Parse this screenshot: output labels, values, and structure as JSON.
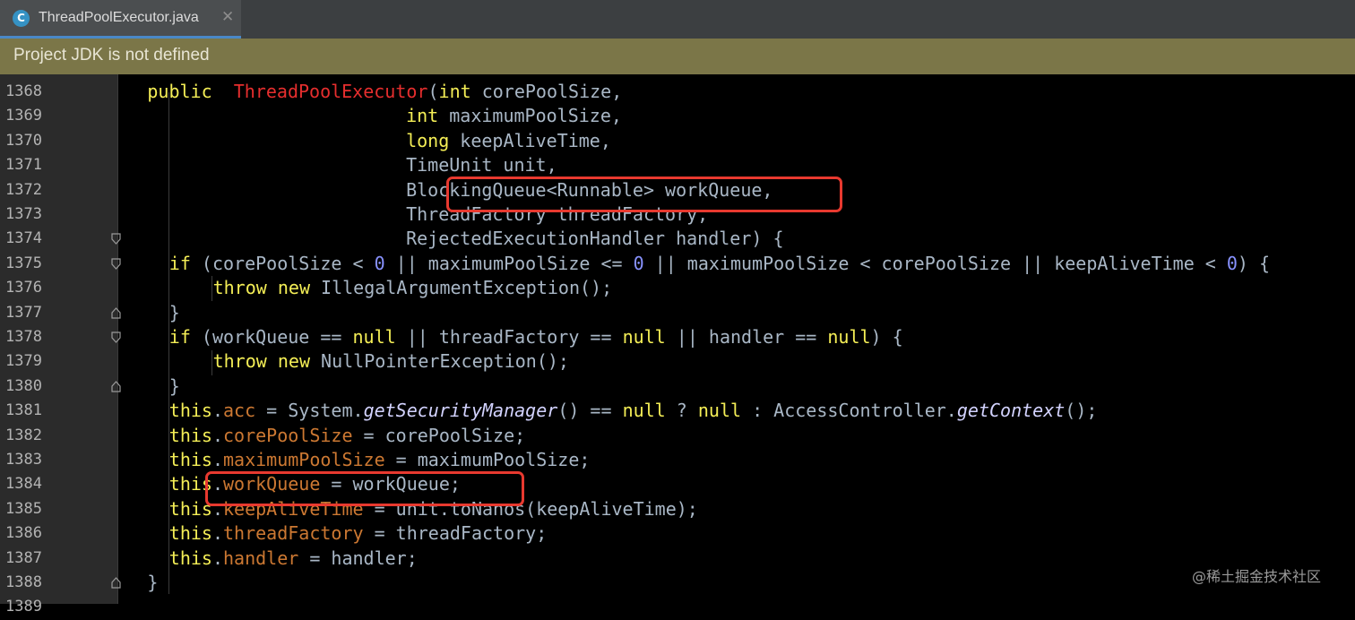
{
  "tab": {
    "icon_letter": "C",
    "title": "ThreadPoolExecutor.java",
    "close_glyph": "✕"
  },
  "banner": {
    "text": "Project JDK is not defined"
  },
  "watermark": "@稀土掘金技术社区",
  "code_lines": [
    {
      "ln": "1368",
      "indent": 2,
      "fold": "",
      "tokens": [
        [
          "kw",
          "public"
        ],
        [
          "",
          "  "
        ],
        [
          "cls",
          "ThreadPoolExecutor"
        ],
        [
          "",
          "("
        ],
        [
          "kw",
          "int"
        ],
        [
          "",
          " corePoolSize,"
        ]
      ]
    },
    {
      "ln": "1369",
      "indent": 0,
      "fold": "",
      "tokens": [
        [
          "",
          "                          "
        ],
        [
          "kw",
          "int"
        ],
        [
          "",
          " maximumPoolSize,"
        ]
      ]
    },
    {
      "ln": "1370",
      "indent": 0,
      "fold": "",
      "tokens": [
        [
          "",
          "                          "
        ],
        [
          "kw",
          "long"
        ],
        [
          "",
          " keepAliveTime,"
        ]
      ]
    },
    {
      "ln": "1371",
      "indent": 0,
      "fold": "",
      "tokens": [
        [
          "",
          "                          TimeUnit unit,"
        ]
      ]
    },
    {
      "ln": "1372",
      "indent": 0,
      "fold": "",
      "tokens": [
        [
          "",
          "                          BlockingQueue<Runnable> workQueue,"
        ]
      ]
    },
    {
      "ln": "1373",
      "indent": 0,
      "fold": "",
      "tokens": [
        [
          "",
          "                          ThreadFactory threadFactory,"
        ]
      ]
    },
    {
      "ln": "1374",
      "indent": 0,
      "fold": "down",
      "tokens": [
        [
          "",
          "                          RejectedExecutionHandler handler) {"
        ]
      ]
    },
    {
      "ln": "1375",
      "indent": 4,
      "fold": "down",
      "tokens": [
        [
          "kw",
          "if"
        ],
        [
          "",
          " (corePoolSize < "
        ],
        [
          "num",
          "0"
        ],
        [
          "",
          " || maximumPoolSize <= "
        ],
        [
          "num",
          "0"
        ],
        [
          "",
          " || maximumPoolSize < corePoolSize || keepAliveTime < "
        ],
        [
          "num",
          "0"
        ],
        [
          "",
          ") {"
        ]
      ]
    },
    {
      "ln": "1376",
      "indent": 8,
      "fold": "",
      "tokens": [
        [
          "kw",
          "throw"
        ],
        [
          "",
          " "
        ],
        [
          "kw",
          "new"
        ],
        [
          "",
          " IllegalArgumentException();"
        ]
      ]
    },
    {
      "ln": "1377",
      "indent": 4,
      "fold": "up",
      "tokens": [
        [
          "",
          "}"
        ]
      ]
    },
    {
      "ln": "1378",
      "indent": 4,
      "fold": "down",
      "tokens": [
        [
          "kw",
          "if"
        ],
        [
          "",
          " (workQueue == "
        ],
        [
          "kw",
          "null"
        ],
        [
          "",
          " || threadFactory == "
        ],
        [
          "kw",
          "null"
        ],
        [
          "",
          " || handler == "
        ],
        [
          "kw",
          "null"
        ],
        [
          "",
          ") {"
        ]
      ]
    },
    {
      "ln": "1379",
      "indent": 8,
      "fold": "",
      "tokens": [
        [
          "kw",
          "throw"
        ],
        [
          "",
          " "
        ],
        [
          "kw",
          "new"
        ],
        [
          "",
          " NullPointerException();"
        ]
      ]
    },
    {
      "ln": "1380",
      "indent": 4,
      "fold": "up",
      "tokens": [
        [
          "",
          "}"
        ]
      ]
    },
    {
      "ln": "1381",
      "indent": 4,
      "fold": "",
      "tokens": [
        [
          "kw",
          "this"
        ],
        [
          "",
          "."
        ],
        [
          "fld",
          "acc"
        ],
        [
          "",
          " = System."
        ],
        [
          "it",
          "getSecurityManager"
        ],
        [
          "",
          "() == "
        ],
        [
          "kw",
          "null"
        ],
        [
          "",
          " ? "
        ],
        [
          "kw",
          "null"
        ],
        [
          "",
          " : AccessController."
        ],
        [
          "it",
          "getContext"
        ],
        [
          "",
          "();"
        ]
      ]
    },
    {
      "ln": "1382",
      "indent": 4,
      "fold": "",
      "tokens": [
        [
          "kw",
          "this"
        ],
        [
          "",
          "."
        ],
        [
          "fld",
          "corePoolSize"
        ],
        [
          "",
          " = corePoolSize;"
        ]
      ]
    },
    {
      "ln": "1383",
      "indent": 4,
      "fold": "",
      "tokens": [
        [
          "kw",
          "this"
        ],
        [
          "",
          "."
        ],
        [
          "fld",
          "maximumPoolSize"
        ],
        [
          "",
          " = maximumPoolSize;"
        ]
      ]
    },
    {
      "ln": "1384",
      "indent": 4,
      "fold": "",
      "tokens": [
        [
          "kw",
          "this"
        ],
        [
          "",
          "."
        ],
        [
          "fld",
          "workQueue"
        ],
        [
          "",
          " = workQueue;"
        ]
      ]
    },
    {
      "ln": "1385",
      "indent": 4,
      "fold": "",
      "tokens": [
        [
          "kw",
          "this"
        ],
        [
          "",
          "."
        ],
        [
          "fld",
          "keepAliveTime"
        ],
        [
          "",
          " = unit.toNanos(keepAliveTime);"
        ]
      ]
    },
    {
      "ln": "1386",
      "indent": 4,
      "fold": "",
      "tokens": [
        [
          "kw",
          "this"
        ],
        [
          "",
          "."
        ],
        [
          "fld",
          "threadFactory"
        ],
        [
          "",
          " = threadFactory;"
        ]
      ]
    },
    {
      "ln": "1387",
      "indent": 4,
      "fold": "",
      "tokens": [
        [
          "kw",
          "this"
        ],
        [
          "",
          "."
        ],
        [
          "fld",
          "handler"
        ],
        [
          "",
          " = handler;"
        ]
      ]
    },
    {
      "ln": "1388",
      "indent": 2,
      "fold": "up",
      "tokens": [
        [
          "",
          "}"
        ]
      ]
    },
    {
      "ln": "1389",
      "indent": 0,
      "fold": "",
      "tokens": []
    }
  ],
  "highlights": [
    "1372",
    "1384"
  ],
  "colors": {
    "keyword": "#f4ee56",
    "class_name": "#e62e2e",
    "number": "#8892ff",
    "field": "#cc7832",
    "text": "#a9b7c6",
    "highlight_box": "#e8392f",
    "banner_bg": "#7b7648"
  }
}
